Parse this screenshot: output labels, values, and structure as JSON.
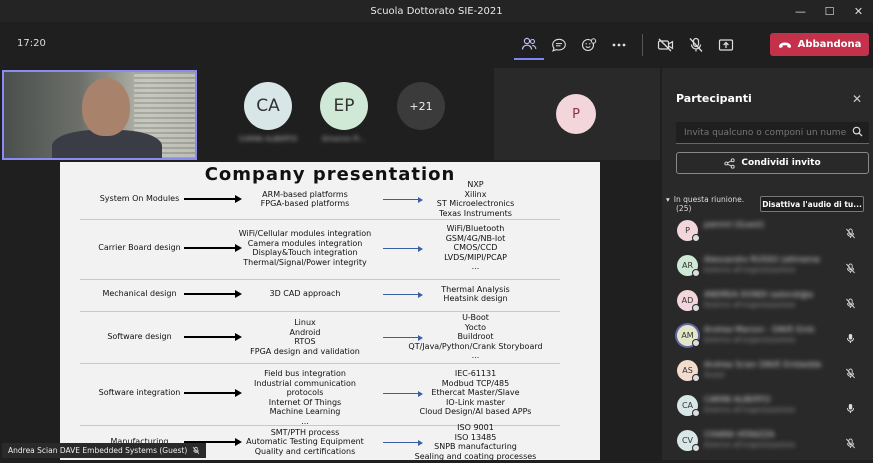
{
  "window": {
    "title": "Scuola Dottorato SIE-2021"
  },
  "toolbar": {
    "clock": "17:20",
    "hangup_label": "Abbandona"
  },
  "stage": {
    "tiles": [
      {
        "initials": "CA",
        "name": "CARINI ALBERTO",
        "bg": "#d9e6e8"
      },
      {
        "initials": "EP",
        "name": "Emanno Pi...",
        "bg": "#cfe9d6"
      }
    ],
    "extra_count": "+21",
    "presenter_initial": "P",
    "caption": "Andrea Scian DAVE Embedded Systems (Guest)"
  },
  "slide": {
    "title": "Company presentation",
    "rows": [
      {
        "cat": "System On Modules",
        "mid": [
          "ARM-based platforms",
          "FPGA-based platforms"
        ],
        "right": [
          "NXP",
          "Xilinx",
          "ST Microelectronics",
          "Texas Instruments"
        ]
      },
      {
        "cat": "Carrier Board design",
        "mid": [
          "WiFi/Cellular modules integration",
          "Camera modules integration",
          "Display&Touch integration",
          "Thermal/Signal/Power integrity"
        ],
        "right": [
          "WiFi/Bluetooth",
          "GSM/4G/NB-Iot",
          "CMOS/CCD",
          "LVDS/MIPI/PCAP",
          "..."
        ]
      },
      {
        "cat": "Mechanical design",
        "mid": [
          "3D CAD approach"
        ],
        "right": [
          "Thermal Analysis",
          "Heatsink design"
        ]
      },
      {
        "cat": "Software design",
        "mid": [
          "Linux",
          "Android",
          "RTOS",
          "FPGA design and validation"
        ],
        "right": [
          "U-Boot",
          "Yocto",
          "Buildroot",
          "QT/Java/Python/Crank Storyboard",
          "..."
        ]
      },
      {
        "cat": "Software integration",
        "mid": [
          "Field bus integration",
          "Industrial communication protocols",
          "Internet Of Things",
          "Machine Learning",
          "..."
        ],
        "right": [
          "IEC-61131",
          "Modbud TCP/485",
          "Ethercat Master/Slave",
          "IO-Link master",
          "Cloud Design/AI based APPs"
        ]
      },
      {
        "cat": "Manufacturing",
        "mid": [
          "SMT/PTH process",
          "Automatic Testing Equipment",
          "Quality and certifications"
        ],
        "right": [
          "ISO 9001",
          "ISO 13485",
          "SNPB manufacturing",
          "Sealing and coating processes"
        ]
      }
    ]
  },
  "panel": {
    "title": "Partecipanti",
    "invite_placeholder": "Invita qualcuno o componi un numero",
    "share_label": "Condividi invito",
    "section_label": "In questa riunione.",
    "section_count": "(25)",
    "mute_all_label": "Disattiva l'audio di tu...",
    "participants": [
      {
        "initials": "P",
        "name": "pamml (Guest)",
        "sub": "",
        "bg": "#f3d6db",
        "mic": "muted"
      },
      {
        "initials": "AR",
        "name": "Alessandro RUSSO (altmeme",
        "sub": "Esterno all'organizzazione",
        "bg": "#cfe9d6",
        "mic": "muted"
      },
      {
        "initials": "AD",
        "name": "ANDREA DONDI (adondi@a",
        "sub": "Esterno all'organizzazione",
        "bg": "#f3d6db",
        "mic": "muted"
      },
      {
        "initials": "AM",
        "name": "Andrea Marson - DAVE Emb",
        "sub": "Esterno all'organizzazione",
        "bg": "#e3e7c8",
        "mic": "on"
      },
      {
        "initials": "AS",
        "name": "Andrea Scian DAVE Embedde",
        "sub": "Guest",
        "bg": "#f3dccd",
        "mic": "muted"
      },
      {
        "initials": "CA",
        "name": "CARINI ALBERTO",
        "sub": "Esterno all'organizzazione",
        "bg": "#d9e6e8",
        "mic": "on"
      },
      {
        "initials": "CV",
        "name": "CHIARA VERAZZA",
        "sub": "Esterno all'organizzazione",
        "bg": "#d9e6e8",
        "mic": "muted"
      }
    ]
  },
  "colors": {
    "accent": "#6264a7",
    "hangup": "#c4314b",
    "active_border": "#8b8cf2"
  }
}
